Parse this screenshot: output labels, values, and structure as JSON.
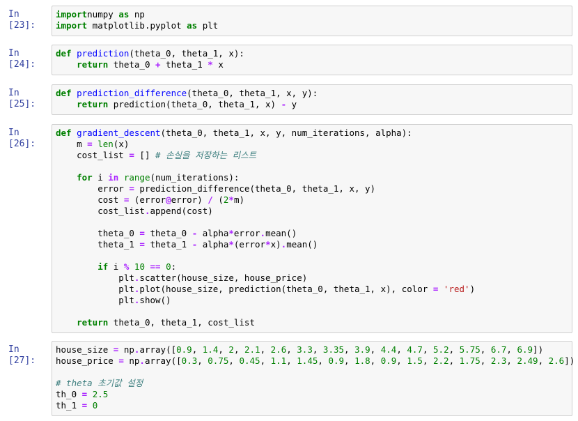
{
  "cells": [
    {
      "prompt": "In [23]:",
      "lines": [
        [
          [
            "k",
            "import"
          ],
          [
            "",
            "numpy "
          ],
          [
            "k",
            "as"
          ],
          [
            "",
            " np"
          ]
        ],
        [
          [
            "k",
            "import"
          ],
          [
            "",
            " matplotlib.pyplot "
          ],
          [
            "k",
            "as"
          ],
          [
            "",
            " plt"
          ]
        ]
      ]
    },
    {
      "prompt": "In [24]:",
      "lines": [
        [
          [
            "k",
            "def"
          ],
          [
            "",
            " "
          ],
          [
            "f",
            "prediction"
          ],
          [
            "",
            "(theta_0, theta_1, x):"
          ]
        ],
        [
          [
            "",
            "    "
          ],
          [
            "k",
            "return"
          ],
          [
            "",
            " theta_0 "
          ],
          [
            "o",
            "+"
          ],
          [
            "",
            " theta_1 "
          ],
          [
            "o",
            "*"
          ],
          [
            "",
            " x"
          ]
        ]
      ]
    },
    {
      "prompt": "In [25]:",
      "lines": [
        [
          [
            "k",
            "def"
          ],
          [
            "",
            " "
          ],
          [
            "f",
            "prediction_difference"
          ],
          [
            "",
            "(theta_0, theta_1, x, y):"
          ]
        ],
        [
          [
            "",
            "    "
          ],
          [
            "k",
            "return"
          ],
          [
            "",
            " prediction(theta_0, theta_1, x) "
          ],
          [
            "o",
            "-"
          ],
          [
            "",
            " y"
          ]
        ]
      ]
    },
    {
      "prompt": "In [26]:",
      "lines": [
        [
          [
            "k",
            "def"
          ],
          [
            "",
            " "
          ],
          [
            "f",
            "gradient_descent"
          ],
          [
            "",
            "(theta_0, theta_1, x, y, num_iterations, alpha):"
          ]
        ],
        [
          [
            "",
            "    m "
          ],
          [
            "o",
            "="
          ],
          [
            "",
            " "
          ],
          [
            "b",
            "len"
          ],
          [
            "",
            "(x)"
          ]
        ],
        [
          [
            "",
            "    cost_list "
          ],
          [
            "o",
            "="
          ],
          [
            "",
            " [] "
          ],
          [
            "c",
            "# 손실을 저장하는 리스트"
          ]
        ],
        [
          [
            "",
            ""
          ]
        ],
        [
          [
            "",
            "    "
          ],
          [
            "k",
            "for"
          ],
          [
            "",
            " i "
          ],
          [
            "o",
            "in"
          ],
          [
            "",
            " "
          ],
          [
            "b",
            "range"
          ],
          [
            "",
            "(num_iterations):"
          ]
        ],
        [
          [
            "",
            "        error "
          ],
          [
            "o",
            "="
          ],
          [
            "",
            " prediction_difference(theta_0, theta_1, x, y)"
          ]
        ],
        [
          [
            "",
            "        cost "
          ],
          [
            "o",
            "="
          ],
          [
            "",
            " (error"
          ],
          [
            "o",
            "@"
          ],
          [
            "",
            "error) "
          ],
          [
            "o",
            "/"
          ],
          [
            "",
            " ("
          ],
          [
            "n",
            "2"
          ],
          [
            "o",
            "*"
          ],
          [
            "",
            "m)"
          ]
        ],
        [
          [
            "",
            "        cost_list"
          ],
          [
            "o",
            "."
          ],
          [
            "",
            "append(cost)"
          ]
        ],
        [
          [
            "",
            ""
          ]
        ],
        [
          [
            "",
            "        theta_0 "
          ],
          [
            "o",
            "="
          ],
          [
            "",
            " theta_0 "
          ],
          [
            "o",
            "-"
          ],
          [
            "",
            " alpha"
          ],
          [
            "o",
            "*"
          ],
          [
            "",
            "error"
          ],
          [
            "o",
            "."
          ],
          [
            "",
            "mean()"
          ]
        ],
        [
          [
            "",
            "        theta_1 "
          ],
          [
            "o",
            "="
          ],
          [
            "",
            " theta_1 "
          ],
          [
            "o",
            "-"
          ],
          [
            "",
            " alpha"
          ],
          [
            "o",
            "*"
          ],
          [
            "",
            "(error"
          ],
          [
            "o",
            "*"
          ],
          [
            "",
            "x)"
          ],
          [
            "o",
            "."
          ],
          [
            "",
            "mean()"
          ]
        ],
        [
          [
            "",
            ""
          ]
        ],
        [
          [
            "",
            "        "
          ],
          [
            "k",
            "if"
          ],
          [
            "",
            " i "
          ],
          [
            "o",
            "%"
          ],
          [
            "",
            " "
          ],
          [
            "n",
            "10"
          ],
          [
            "",
            " "
          ],
          [
            "o",
            "=="
          ],
          [
            "",
            " "
          ],
          [
            "n",
            "0"
          ],
          [
            "",
            ":"
          ]
        ],
        [
          [
            "",
            "            plt"
          ],
          [
            "o",
            "."
          ],
          [
            "",
            "scatter(house_size, house_price)"
          ]
        ],
        [
          [
            "",
            "            plt"
          ],
          [
            "o",
            "."
          ],
          [
            "",
            "plot(house_size, prediction(theta_0, theta_1, x), color "
          ],
          [
            "o",
            "="
          ],
          [
            "",
            " "
          ],
          [
            "s",
            "'red'"
          ],
          [
            "",
            ")"
          ]
        ],
        [
          [
            "",
            "            plt"
          ],
          [
            "o",
            "."
          ],
          [
            "",
            "show()"
          ]
        ],
        [
          [
            "",
            ""
          ]
        ],
        [
          [
            "",
            "    "
          ],
          [
            "k",
            "return"
          ],
          [
            "",
            " theta_0, theta_1, cost_list"
          ]
        ]
      ]
    },
    {
      "prompt": "In [27]:",
      "lines": [
        [
          [
            "",
            "house_size "
          ],
          [
            "o",
            "="
          ],
          [
            "",
            " np"
          ],
          [
            "o",
            "."
          ],
          [
            "",
            "array(["
          ],
          [
            "n",
            "0.9"
          ],
          [
            "",
            ", "
          ],
          [
            "n",
            "1.4"
          ],
          [
            "",
            ", "
          ],
          [
            "n",
            "2"
          ],
          [
            "",
            ", "
          ],
          [
            "n",
            "2.1"
          ],
          [
            "",
            ", "
          ],
          [
            "n",
            "2.6"
          ],
          [
            "",
            ", "
          ],
          [
            "n",
            "3.3"
          ],
          [
            "",
            ", "
          ],
          [
            "n",
            "3.35"
          ],
          [
            "",
            ", "
          ],
          [
            "n",
            "3.9"
          ],
          [
            "",
            ", "
          ],
          [
            "n",
            "4.4"
          ],
          [
            "",
            ", "
          ],
          [
            "n",
            "4.7"
          ],
          [
            "",
            ", "
          ],
          [
            "n",
            "5.2"
          ],
          [
            "",
            ", "
          ],
          [
            "n",
            "5.75"
          ],
          [
            "",
            ", "
          ],
          [
            "n",
            "6.7"
          ],
          [
            "",
            ", "
          ],
          [
            "n",
            "6.9"
          ],
          [
            "",
            "])"
          ]
        ],
        [
          [
            "",
            "house_price "
          ],
          [
            "o",
            "="
          ],
          [
            "",
            " np"
          ],
          [
            "o",
            "."
          ],
          [
            "",
            "array(["
          ],
          [
            "n",
            "0.3"
          ],
          [
            "",
            ", "
          ],
          [
            "n",
            "0.75"
          ],
          [
            "",
            ", "
          ],
          [
            "n",
            "0.45"
          ],
          [
            "",
            ", "
          ],
          [
            "n",
            "1.1"
          ],
          [
            "",
            ", "
          ],
          [
            "n",
            "1.45"
          ],
          [
            "",
            ", "
          ],
          [
            "n",
            "0.9"
          ],
          [
            "",
            ", "
          ],
          [
            "n",
            "1.8"
          ],
          [
            "",
            ", "
          ],
          [
            "n",
            "0.9"
          ],
          [
            "",
            ", "
          ],
          [
            "n",
            "1.5"
          ],
          [
            "",
            ", "
          ],
          [
            "n",
            "2.2"
          ],
          [
            "",
            ", "
          ],
          [
            "n",
            "1.75"
          ],
          [
            "",
            ", "
          ],
          [
            "n",
            "2.3"
          ],
          [
            "",
            ", "
          ],
          [
            "n",
            "2.49"
          ],
          [
            "",
            ", "
          ],
          [
            "n",
            "2.6"
          ],
          [
            "",
            "])"
          ]
        ],
        [
          [
            "",
            ""
          ]
        ],
        [
          [
            "c",
            "# theta 초기값 설정"
          ]
        ],
        [
          [
            "",
            "th_0 "
          ],
          [
            "o",
            "="
          ],
          [
            "",
            " "
          ],
          [
            "n",
            "2.5"
          ]
        ],
        [
          [
            "",
            "th_1 "
          ],
          [
            "o",
            "="
          ],
          [
            "",
            " "
          ],
          [
            "n",
            "0"
          ]
        ]
      ]
    }
  ]
}
